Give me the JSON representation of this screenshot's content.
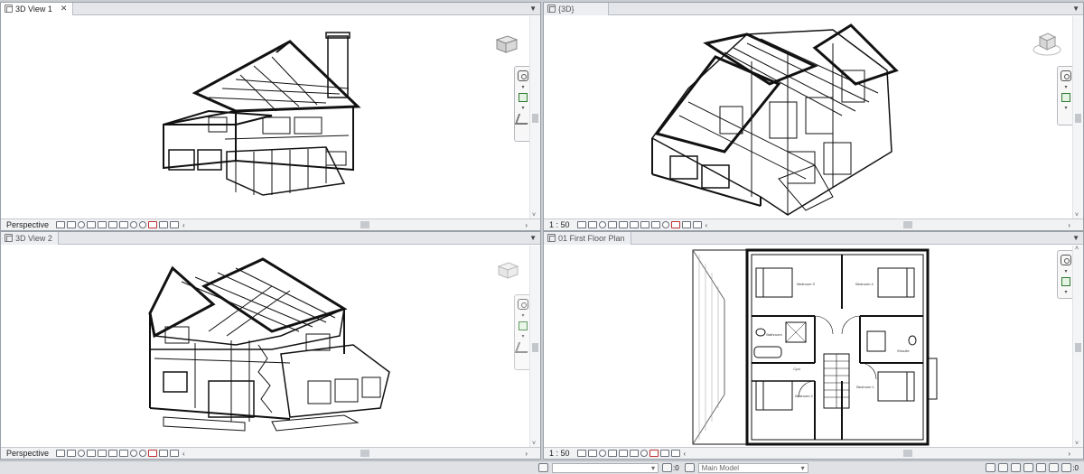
{
  "views": [
    {
      "tab_label": "3D View 1",
      "active": true,
      "scale_label": "Perspective",
      "viewcube": "viewcube-home-icon"
    },
    {
      "tab_label": "{3D}",
      "active": false,
      "scale_label": "1 : 50",
      "viewcube": "viewcube-icon"
    },
    {
      "tab_label": "3D View 2",
      "active": false,
      "scale_label": "Perspective",
      "viewcube": "viewcube-icon"
    },
    {
      "tab_label": "01 First Floor Plan",
      "active": false,
      "scale_label": "1 : 50",
      "viewcube": "none"
    }
  ],
  "floor_plan": {
    "rooms": [
      "Bedroom 3",
      "Bedroom 4",
      "Bedroom 2",
      "Bedroom 1",
      "Bathroom",
      "Ensuite",
      "Cpd"
    ]
  },
  "statusbar": {
    "workset_count": ":0",
    "model_dropdown": "Main Model",
    "filter_count": ":0"
  },
  "colors": {
    "background": "#c9ccd1",
    "tab_active": "#ffffff",
    "pane_border": "#9aa0a8"
  }
}
